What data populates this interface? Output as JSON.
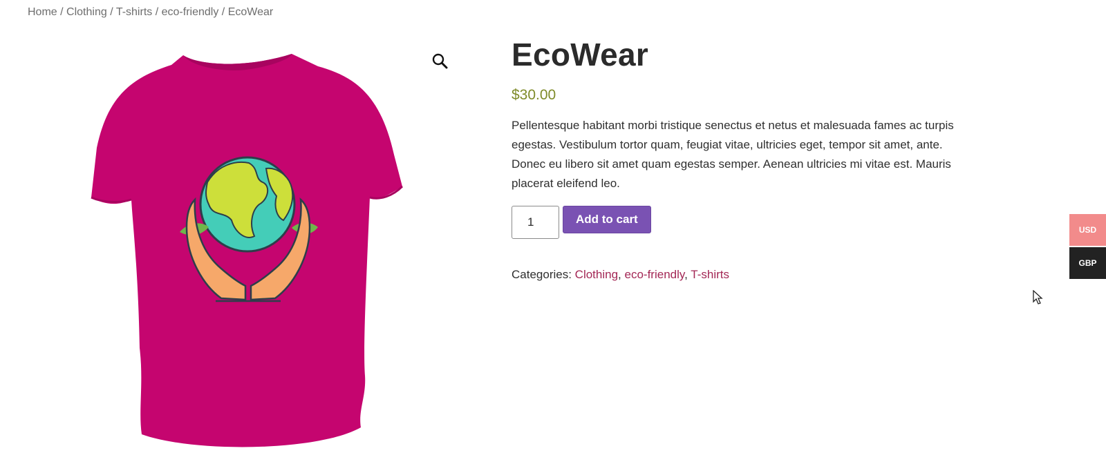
{
  "breadcrumb": {
    "items": [
      "Home",
      "Clothing",
      "T-shirts",
      "eco-friendly"
    ],
    "current": "EcoWear",
    "separator": "/"
  },
  "gallery": {
    "zoom_icon": "search-icon",
    "image_alt": "EcoWear t-shirt",
    "shirt_color": "#c5056f"
  },
  "product": {
    "title": "EcoWear",
    "price": "$30.00",
    "description": "Pellentesque habitant morbi tristique senectus et netus et malesuada fames ac turpis egestas. Vestibulum tortor quam, feugiat vitae, ultricies eget, tempor sit amet, ante. Donec eu libero sit amet quam egestas semper. Aenean ultricies mi vitae est. Mauris placerat eleifend leo.",
    "quantity": "1",
    "add_to_cart_label": "Add to cart",
    "categories_label": "Categories:",
    "categories": [
      "Clothing",
      "eco-friendly",
      "T-shirts"
    ]
  },
  "currency_switcher": {
    "options": [
      "USD",
      "GBP"
    ],
    "active": "USD"
  },
  "colors": {
    "price": "#7f8b2a",
    "button": "#7a52b3",
    "link": "#a32755",
    "usd_bg": "#f28b8b",
    "gbp_bg": "#222222"
  }
}
